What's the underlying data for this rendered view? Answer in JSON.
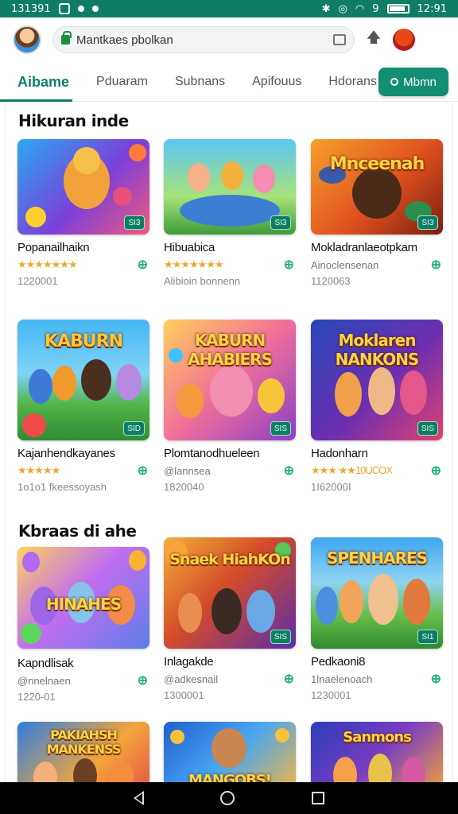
{
  "status": {
    "time_left": "131391",
    "time_right": "12:91",
    "signal": "9"
  },
  "browser": {
    "url": "Mantkaes pbolkan"
  },
  "tabs": [
    {
      "label": "Aibame"
    },
    {
      "label": "Pduaram"
    },
    {
      "label": "Subnans"
    },
    {
      "label": "Apifouus"
    },
    {
      "label": "Hdorans"
    }
  ],
  "tab_button": {
    "label": "Mbmn"
  },
  "sections": [
    {
      "title": "Hikuran inde"
    },
    {
      "title": "Kbraas di ahe"
    }
  ],
  "cards": [
    {
      "title": "Popanailhaikn",
      "stars": "★★★★★★★",
      "sub": "",
      "num": "1220001",
      "badge": "SI3",
      "art": ""
    },
    {
      "title": "Hibuabica",
      "stars": "★★★★★★★",
      "sub": "",
      "num": "Alibioin bonnenn",
      "badge": "SI3",
      "art": ""
    },
    {
      "title": "Mokladranlaeotpkam",
      "stars": "",
      "sub": "Ainoclensenan",
      "num": "1120063",
      "badge": "SI3",
      "art": "Mnceenah"
    },
    {
      "title": "Kajanhendkayanes",
      "stars": "★★★★★",
      "sub": "",
      "num": "1o1o1 fkeessoyash",
      "badge": "SID",
      "art": "KABURN"
    },
    {
      "title": "Plomtanodhueleen",
      "stars": "",
      "sub": "@lannsea",
      "num": "1820040",
      "badge": "SIS",
      "art": "KABURN AHABIERS"
    },
    {
      "title": "Hadonharn",
      "stars": "★★★ ★★10UCOX",
      "sub": "",
      "num": "1I62000I",
      "badge": "SIS",
      "art": "Moklaren NANKONS"
    },
    {
      "title": "Kapndlisak",
      "stars": "",
      "sub": "@nnelnaen",
      "num": "1220-01",
      "badge": "",
      "art": "HINAHES"
    },
    {
      "title": "Inlagakde",
      "stars": "",
      "sub": "@adkesnail",
      "num": "1300001",
      "badge": "SIS",
      "art": "Snaek HiahKOn"
    },
    {
      "title": "Pedkaoni8",
      "stars": "",
      "sub": "1lnaelenoach",
      "num": "1230001",
      "badge": "SI1",
      "art": "SPENHARES"
    },
    {
      "title": "",
      "stars": "",
      "sub": "",
      "num": "",
      "badge": "",
      "art": "PAKIAHSH MANKENSS"
    },
    {
      "title": "",
      "stars": "",
      "sub": "",
      "num": "",
      "badge": "",
      "art": "MANGOBS!"
    },
    {
      "title": "",
      "stars": "",
      "sub": "",
      "num": "",
      "badge": "",
      "art": "Sanmons"
    }
  ]
}
